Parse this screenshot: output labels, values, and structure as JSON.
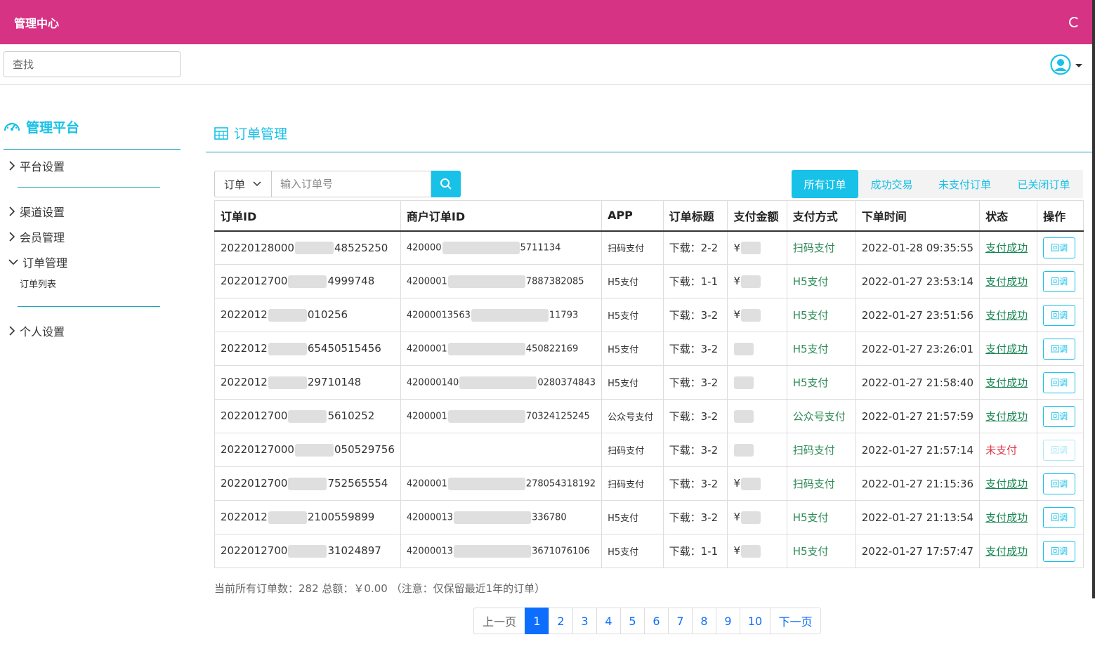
{
  "app": {
    "title": "管理中心"
  },
  "search": {
    "placeholder": "查找"
  },
  "sidebar": {
    "brand": "管理平台",
    "items": [
      {
        "label": "平台设置"
      },
      {
        "label": "渠道设置"
      },
      {
        "label": "会员管理"
      },
      {
        "label": "订单管理"
      },
      {
        "label": "个人设置"
      }
    ],
    "sub_items": [
      {
        "label": "订单列表"
      }
    ]
  },
  "main": {
    "title": "订单管理",
    "filter": {
      "select_label": "订单",
      "input_placeholder": "输入订单号"
    },
    "tabs": [
      {
        "label": "所有订单",
        "active": true
      },
      {
        "label": "成功交易"
      },
      {
        "label": "未支付订单"
      },
      {
        "label": "已关闭订单"
      }
    ],
    "table": {
      "headers": [
        "订单ID",
        "商户订单ID",
        "APP",
        "订单标题",
        "支付金额",
        "支付方式",
        "下单时间",
        "状态",
        "操作"
      ],
      "rows": [
        {
          "id_a": "20220128000",
          "id_b": "48525250",
          "mid_a": "420000",
          "mid_b": "5711134",
          "app": "扫码支付",
          "title": "下载：2-2",
          "amount": "¥",
          "method": "扫码支付",
          "time": "2022-01-28 09:35:55",
          "status": "支付成功",
          "action": "回调"
        },
        {
          "id_a": "2022012700",
          "id_b": "4999748",
          "mid_a": "4200001",
          "mid_b": "7887382085",
          "app": "H5支付",
          "title": "下载：1-1",
          "amount": "¥",
          "method": "H5支付",
          "time": "2022-01-27 23:53:14",
          "status": "支付成功",
          "action": "回调"
        },
        {
          "id_a": "2022012",
          "id_b": "010256",
          "mid_a": "42000013563",
          "mid_b": "11793",
          "app": "H5支付",
          "title": "下载：3-2",
          "amount": "¥",
          "method": "H5支付",
          "time": "2022-01-27 23:51:56",
          "status": "支付成功",
          "action": "回调"
        },
        {
          "id_a": "2022012",
          "id_b": "65450515456",
          "mid_a": "4200001",
          "mid_b": "450822169",
          "app": "H5支付",
          "title": "下载：3-2",
          "amount": "",
          "method": "H5支付",
          "time": "2022-01-27 23:26:01",
          "status": "支付成功",
          "action": "回调"
        },
        {
          "id_a": "2022012",
          "id_b": "29710148",
          "mid_a": "420000140",
          "mid_b": "0280374843",
          "app": "H5支付",
          "title": "下载：3-2",
          "amount": "",
          "method": "H5支付",
          "time": "2022-01-27 21:58:40",
          "status": "支付成功",
          "action": "回调"
        },
        {
          "id_a": "2022012700",
          "id_b": "5610252",
          "mid_a": "4200001",
          "mid_b": "70324125245",
          "app": "公众号支付",
          "title": "下载：3-2",
          "amount": "",
          "method": "公众号支付",
          "time": "2022-01-27 21:57:59",
          "status": "支付成功",
          "action": "回调"
        },
        {
          "id_a": "20220127000",
          "id_b": "050529756",
          "mid_a": "",
          "mid_b": "",
          "app": "扫码支付",
          "title": "下载：3-2",
          "amount": "",
          "method": "扫码支付",
          "time": "2022-01-27 21:57:14",
          "status": "未支付",
          "action": "回调"
        },
        {
          "id_a": "2022012700",
          "id_b": "752565554",
          "mid_a": "4200001",
          "mid_b": "278054318192",
          "app": "扫码支付",
          "title": "下载：3-2",
          "amount": "¥",
          "method": "扫码支付",
          "time": "2022-01-27 21:15:36",
          "status": "支付成功",
          "action": "回调"
        },
        {
          "id_a": "2022012",
          "id_b": "2100559899",
          "mid_a": "42000013",
          "mid_b": "336780",
          "app": "H5支付",
          "title": "下载：3-2",
          "amount": "¥",
          "method": "H5支付",
          "time": "2022-01-27 21:13:54",
          "status": "支付成功",
          "action": "回调"
        },
        {
          "id_a": "2022012700",
          "id_b": "31024897",
          "mid_a": "42000013",
          "mid_b": "3671076106",
          "app": "H5支付",
          "title": "下载：1-1",
          "amount": "¥",
          "method": "H5支付",
          "time": "2022-01-27 17:57:47",
          "status": "支付成功",
          "action": "回调"
        }
      ]
    },
    "summary": "当前所有订单数：282 总额：￥0.00 （注意：仅保留最近1年的订单）",
    "pagination": {
      "prev": "上一页",
      "next": "下一页",
      "pages": [
        "1",
        "2",
        "3",
        "4",
        "5",
        "6",
        "7",
        "8",
        "9",
        "10"
      ],
      "current": "1"
    }
  },
  "colors": {
    "topbar": "#d63384",
    "accent": "#17c1e8",
    "success": "#198754",
    "danger": "#dc3545",
    "page_active": "#0d6efd"
  }
}
